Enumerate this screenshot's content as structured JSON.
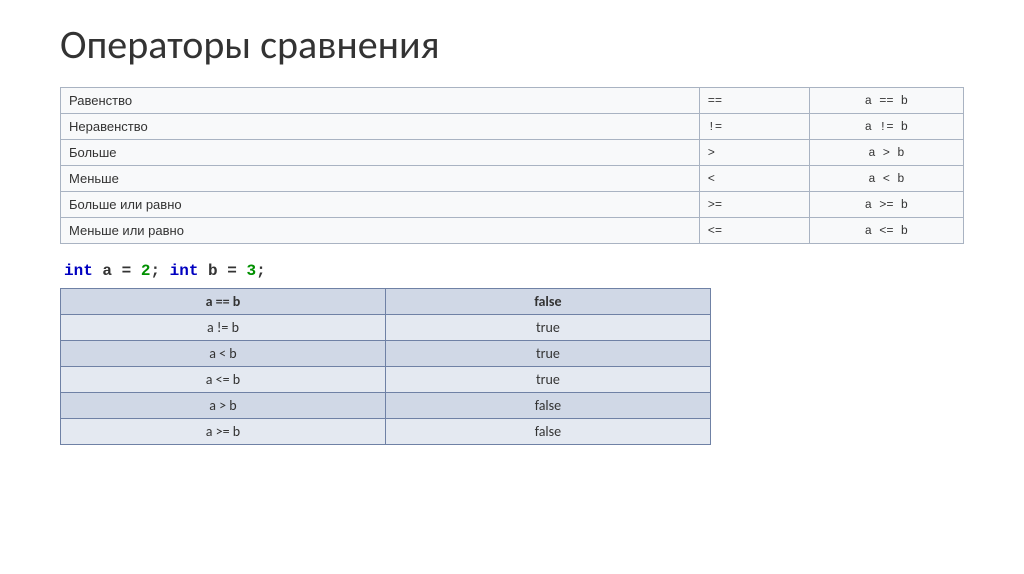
{
  "title": "Операторы сравнения",
  "operators": [
    {
      "name": "Равенство",
      "op": "==",
      "expr": "a == b"
    },
    {
      "name": "Неравенство",
      "op": "!=",
      "expr": "a != b"
    },
    {
      "name": "Больше",
      "op": ">",
      "expr": "a > b"
    },
    {
      "name": "Меньше",
      "op": "<",
      "expr": "a < b"
    },
    {
      "name": "Больше или равно",
      "op": ">=",
      "expr": "a >= b"
    },
    {
      "name": "Меньше или равно",
      "op": "<=",
      "expr": "a <= b"
    }
  ],
  "code": {
    "kw1": "int",
    "decl1": " a = ",
    "num1": "2",
    "sep": "; ",
    "kw2": "int",
    "decl2": " b = ",
    "num2": "3",
    "end": ";"
  },
  "results_header": {
    "expr": "a == b",
    "val": "false"
  },
  "results": [
    {
      "expr": "a != b",
      "val": "true"
    },
    {
      "expr": "a < b",
      "val": "true"
    },
    {
      "expr": "a <= b",
      "val": "true"
    },
    {
      "expr": "a > b",
      "val": "false"
    },
    {
      "expr": "a >= b",
      "val": "false"
    }
  ]
}
